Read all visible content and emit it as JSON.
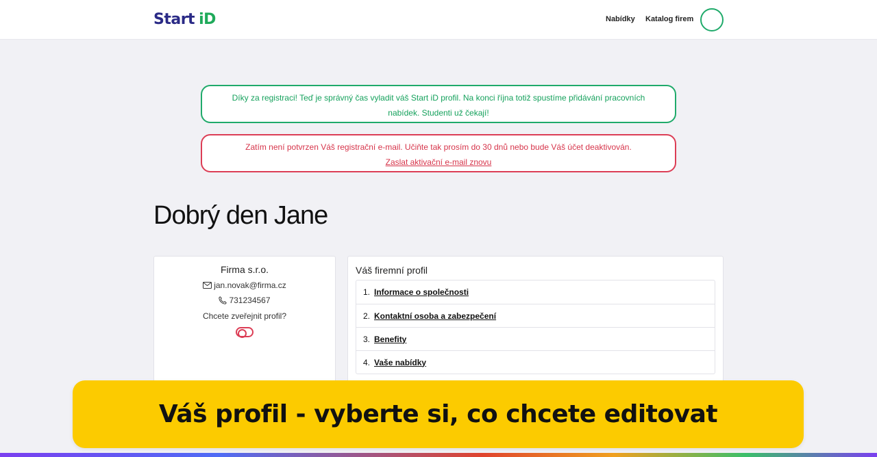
{
  "header": {
    "logo_start": "Start",
    "logo_id": "iD",
    "nav_offers": "Nabídky",
    "nav_catalog": "Katalog firem"
  },
  "alerts": {
    "success_text": "Díky za registraci! Teď je správný čas vyladit váš Start iD profil. Na konci října totiž spustíme přidávání pracovních nabídek. Studenti už čekají!",
    "danger_text": "Zatím není potvrzen Váš registrační e-mail. Učiňte tak prosím do 30 dnů nebo bude Váš účet deaktivován.",
    "danger_link": "Zaslat aktivační e-mail znovu"
  },
  "greeting": "Dobrý den Jane",
  "profile_card": {
    "company": "Firma s.r.o.",
    "email": "jan.novak@firma.cz",
    "phone": "731234567",
    "publish_question": "Chcete zveřejnit profil?"
  },
  "company_profile": {
    "title": "Váš firemní profil",
    "items": [
      {
        "num": "1.",
        "label": "Informace o společnosti"
      },
      {
        "num": "2.",
        "label": "Kontaktní osoba a zabezpečení"
      },
      {
        "num": "3.",
        "label": "Benefity"
      },
      {
        "num": "4.",
        "label": "Vaše nabídky"
      }
    ]
  },
  "banner": {
    "text": "Váš profil - vyberte si, co chcete editovat"
  },
  "colors": {
    "brand_navy": "#2a2a86",
    "brand_green": "#1faa6a",
    "danger_red": "#dc3d55",
    "banner_yellow": "#fccb00"
  },
  "icons": {
    "email": "envelope-icon",
    "phone": "phone-icon"
  }
}
